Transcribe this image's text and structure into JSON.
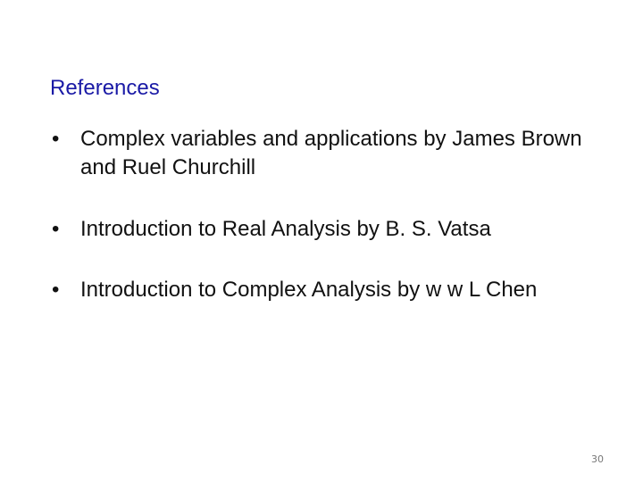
{
  "slide": {
    "title": "References",
    "bullet_glyph": "•",
    "references": [
      {
        "text": "Complex variables and applications by James Brown and Ruel Churchill"
      },
      {
        "text": "Introduction to Real Analysis by B. S. Vatsa"
      },
      {
        "text": "Introduction to Complex Analysis by w w L Chen"
      }
    ],
    "page_number": "30",
    "colors": {
      "title": "#1a1aa6",
      "body": "#111111",
      "page_number": "#777777"
    }
  }
}
